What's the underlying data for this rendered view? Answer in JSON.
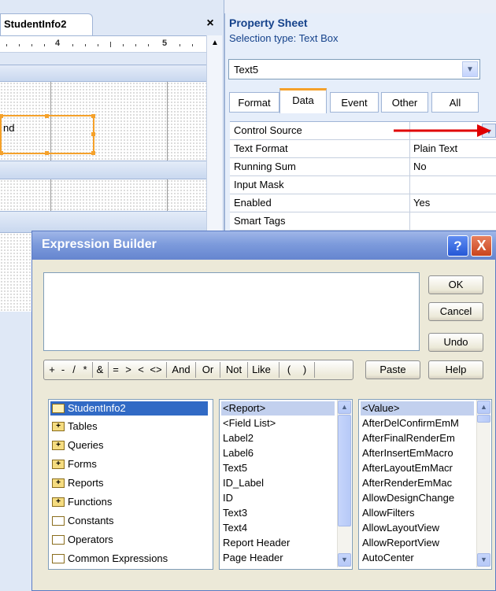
{
  "designer": {
    "tab_label": "StudentInfo2",
    "close_glyph": "×",
    "ruler": {
      "mark_4": "4",
      "mark_5": "5"
    },
    "field_fragment": "nd"
  },
  "property_sheet": {
    "title": "Property Sheet",
    "selection_type": "Selection type:  Text Box",
    "selected_control": "Text5",
    "tabs": [
      "Format",
      "Data",
      "Event",
      "Other",
      "All"
    ],
    "active_tab": "Data",
    "rows": [
      {
        "name": "Control Source",
        "value": ""
      },
      {
        "name": "Text Format",
        "value": "Plain Text"
      },
      {
        "name": "Running Sum",
        "value": "No"
      },
      {
        "name": "Input Mask",
        "value": ""
      },
      {
        "name": "Enabled",
        "value": "Yes"
      },
      {
        "name": "Smart Tags",
        "value": ""
      }
    ],
    "arrow_color": "#e00000"
  },
  "expression_builder": {
    "title": "Expression Builder",
    "help_glyph": "?",
    "close_glyph": "X",
    "expression_value": "",
    "buttons": {
      "ok": "OK",
      "cancel": "Cancel",
      "undo": "Undo",
      "paste": "Paste",
      "help": "Help"
    },
    "operators": [
      "+",
      "-",
      "/",
      "*",
      "&",
      "=",
      ">",
      "<",
      "<>",
      "And",
      "Or",
      "Not",
      "Like",
      "(",
      ")"
    ],
    "folders": [
      "StudentInfo2",
      "Tables",
      "Queries",
      "Forms",
      "Reports",
      "Functions",
      "Constants",
      "Operators",
      "Common Expressions"
    ],
    "middle_list": [
      "<Report>",
      "<Field List>",
      "Label2",
      "Label6",
      "Text5",
      "ID_Label",
      "ID",
      "Text3",
      "Text4",
      "Report Header",
      "Page Header"
    ],
    "right_list": [
      "<Value>",
      "AfterDelConfirmEmM",
      "AfterFinalRenderEm",
      "AfterInsertEmMacro",
      "AfterLayoutEmMacr",
      "AfterRenderEmMac",
      "AllowDesignChange",
      "AllowFilters",
      "AllowLayoutView",
      "AllowReportView",
      "AutoCenter"
    ]
  }
}
